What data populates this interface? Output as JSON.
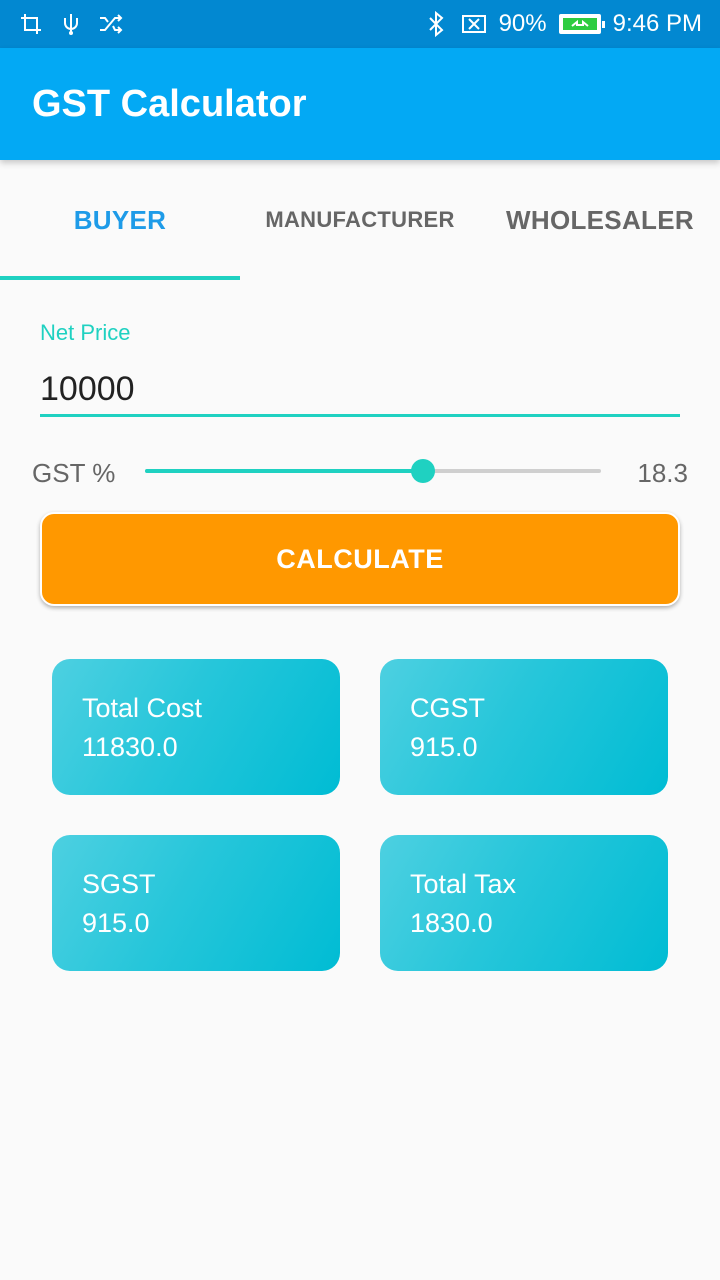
{
  "status_bar": {
    "battery_percent": "90%",
    "time": "9:46 PM",
    "icons_left": [
      "crop-icon",
      "usb-icon",
      "shuffle-icon"
    ],
    "icons_right": [
      "bluetooth-icon",
      "no-sim-icon",
      "battery-charging-icon"
    ]
  },
  "app_bar": {
    "title": "GST Calculator",
    "color": "#03a9f4"
  },
  "tabs": [
    {
      "label": "BUYER",
      "active": true
    },
    {
      "label": "MANUFACTURER",
      "active": false
    },
    {
      "label": "WHOLESALER",
      "active": false
    }
  ],
  "net_price": {
    "label": "Net Price",
    "value": "10000"
  },
  "gst": {
    "label": "GST %",
    "value": "18.3",
    "slider_fraction": 0.61
  },
  "calculate": {
    "label": "CALCULATE",
    "color": "#ff9800"
  },
  "results": [
    {
      "title": "Total Cost",
      "value": "11830.0"
    },
    {
      "title": "CGST",
      "value": "915.0"
    },
    {
      "title": "SGST",
      "value": "915.0"
    },
    {
      "title": "Total Tax",
      "value": "1830.0"
    }
  ],
  "accent_color": "#1fd1c1"
}
